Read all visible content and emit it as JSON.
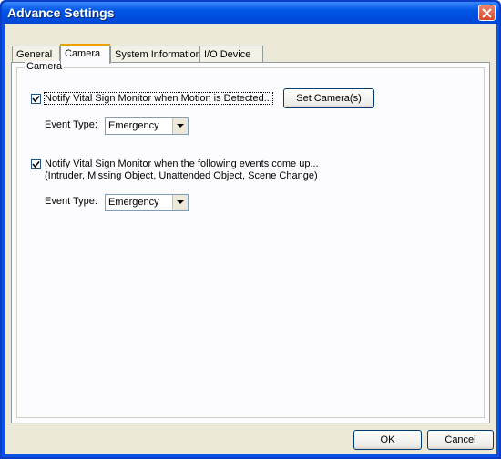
{
  "window": {
    "title": "Advance Settings"
  },
  "tabs": [
    {
      "label": "General"
    },
    {
      "label": "Camera"
    },
    {
      "label": "System Information"
    },
    {
      "label": "I/O Device"
    }
  ],
  "camera": {
    "group_label": "Camera",
    "motion": {
      "checked": true,
      "label": "Notify Vital Sign Monitor when Motion is Detected...",
      "set_camera_button": "Set Camera(s)",
      "event_type_label": "Event Type:",
      "event_type_value": "Emergency"
    },
    "events": {
      "checked": true,
      "label_line1": "Notify Vital Sign Monitor when the following events come up...",
      "label_line2": "(Intruder, Missing Object, Unattended Object, Scene Change)",
      "event_type_label": "Event Type:",
      "event_type_value": "Emergency"
    }
  },
  "footer": {
    "ok_label": "OK",
    "cancel_label": "Cancel"
  },
  "icons": {
    "close": "close-icon",
    "check": "checkmark-icon",
    "dropdown": "chevron-down-icon"
  }
}
